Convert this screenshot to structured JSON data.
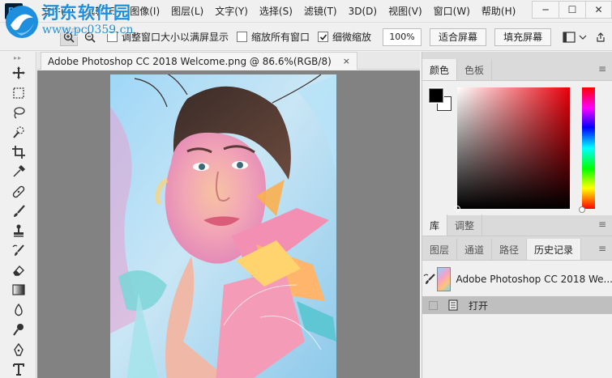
{
  "watermark": {
    "title": "河东软件园",
    "url": "www.pc0359.cn"
  },
  "menubar": {
    "app_icon": "Ps",
    "items": [
      "文件(F)",
      "编辑(E)",
      "图像(I)",
      "图层(L)",
      "文字(Y)",
      "选择(S)",
      "滤镜(T)",
      "3D(D)",
      "视图(V)",
      "窗口(W)",
      "帮助(H)"
    ],
    "window_controls": {
      "minimize": "─",
      "maximize": "☐",
      "close": "✕"
    }
  },
  "options": {
    "resize_windows": {
      "label": "调整窗口大小以满屏显示",
      "checked": false
    },
    "zoom_all": {
      "label": "缩放所有窗口",
      "checked": false
    },
    "scrubby_zoom": {
      "label": "细微缩放",
      "checked": true
    },
    "zoom_value": "100%",
    "fit_screen": "适合屏幕",
    "fill_screen": "填充屏幕"
  },
  "tools": [
    "move-tool-icon",
    "marquee-tool-icon",
    "lasso-tool-icon",
    "quick-select-tool-icon",
    "crop-tool-icon",
    "eyedropper-tool-icon",
    "healing-brush-icon",
    "brush-tool-icon",
    "clone-stamp-icon",
    "history-brush-icon",
    "eraser-tool-icon",
    "gradient-tool-icon",
    "blur-tool-icon",
    "dodge-tool-icon",
    "pen-tool-icon",
    "type-tool-icon"
  ],
  "document": {
    "tab_title": "Adobe Photoshop CC 2018 Welcome.png @ 86.6%(RGB/8)",
    "close": "×"
  },
  "panels": {
    "color_tabs": [
      "颜色",
      "色板"
    ],
    "library_tabs": [
      "库",
      "调整"
    ],
    "history_tabs": [
      "图层",
      "通道",
      "路径",
      "历史记录"
    ],
    "menu_icon": "≡",
    "foreground_color": "#000000",
    "background_color": "#ffffff",
    "history": {
      "snapshot_label": "Adobe Photoshop CC 2018 We...",
      "state_label": "打开"
    }
  }
}
